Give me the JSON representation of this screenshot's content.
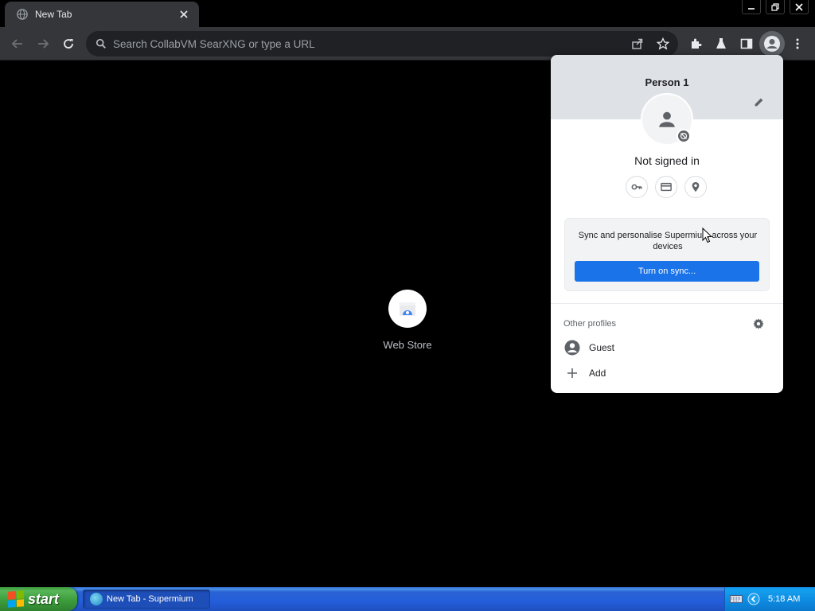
{
  "window": {
    "tab": {
      "title": "New Tab",
      "favicon": "globe-icon",
      "close_icon": "close-icon"
    },
    "controls": [
      "minimize-icon",
      "restore-icon",
      "close-icon"
    ]
  },
  "toolbar": {
    "back_icon": "arrow-left-icon",
    "forward_icon": "arrow-right-icon",
    "reload_icon": "reload-icon",
    "omnibox": {
      "placeholder": "Search CollabVM SearXNG or type a URL",
      "value": ""
    },
    "right_icons": [
      "share-icon",
      "star-icon",
      "extensions-icon",
      "flask-icon",
      "side-panel-icon",
      "avatar-icon",
      "menu-icon"
    ]
  },
  "new_tab": {
    "shortcut": {
      "label": "Web Store",
      "icon": "web-store-icon"
    }
  },
  "profile_menu": {
    "name": "Person 1",
    "status": "Not signed in",
    "quick_actions": [
      "key-icon",
      "card-icon",
      "location-icon"
    ],
    "sync": {
      "message": "Sync and personalise Supermium across your devices",
      "button": "Turn on sync..."
    },
    "other_profiles": {
      "title": "Other profiles",
      "items": [
        {
          "label": "Guest",
          "icon": "guest-avatar-icon"
        },
        {
          "label": "Add",
          "icon": "plus-icon"
        }
      ]
    }
  },
  "taskbar": {
    "start_label": "start",
    "task": {
      "label": "New Tab - Supermium"
    },
    "clock": "5:18 AM"
  },
  "colors": {
    "accent": "#1a73e8",
    "toolbar": "#35363a",
    "taskbar": "#245edb",
    "start": "#3a9a3a"
  }
}
